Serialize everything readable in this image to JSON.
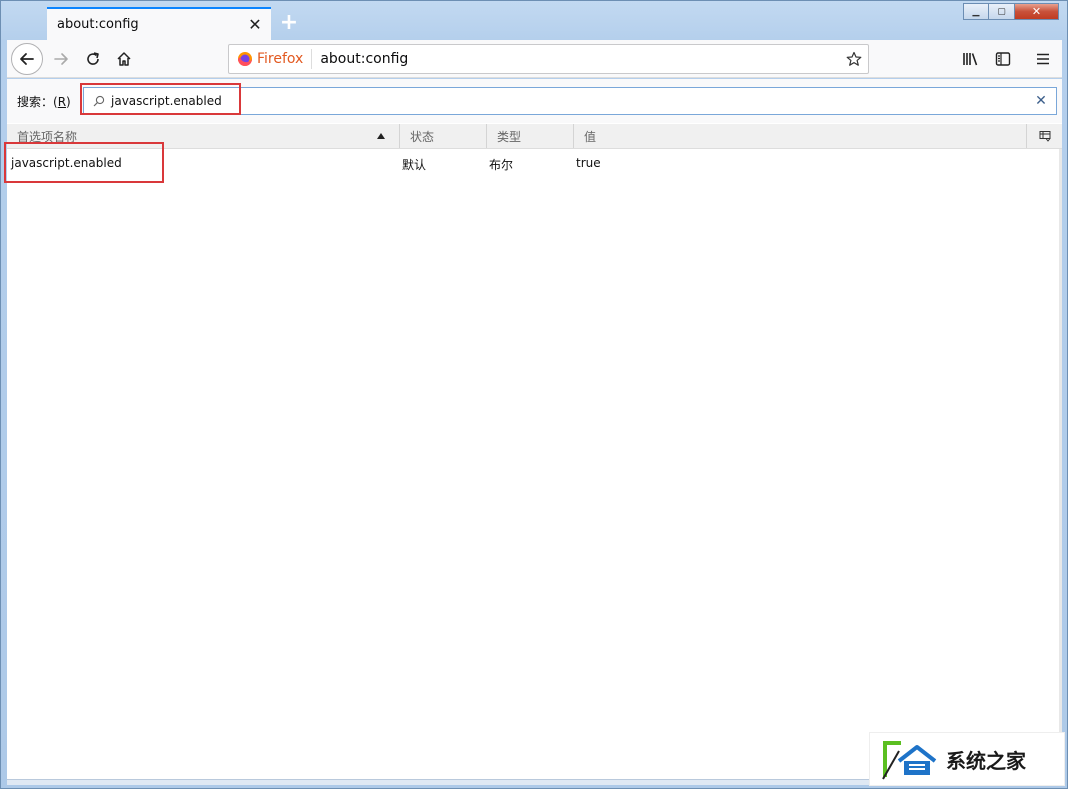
{
  "tab": {
    "title": "about:config",
    "close_label": "✕",
    "new_tab_label": "+"
  },
  "window_controls": {
    "minimize": "▁",
    "maximize": "▢",
    "close": "✕"
  },
  "navbar": {
    "identity_label": "Firefox",
    "url": "about:config"
  },
  "search": {
    "label_prefix": "搜索：(",
    "label_key": "R",
    "label_suffix": ")",
    "value": "javascript.enabled",
    "clear_label": "✕"
  },
  "table": {
    "columns": [
      "首选项名称",
      "状态",
      "类型",
      "值"
    ],
    "sorted_column": "首选项名称",
    "rows": [
      {
        "name": "javascript.enabled",
        "status": "默认",
        "type": "布尔",
        "value": "true"
      }
    ]
  },
  "watermark": {
    "text": "系统之家"
  },
  "colors": {
    "accent": "#0a84ff",
    "highlight_box": "#d9383a",
    "firefox_orange": "#e25920",
    "window_frame": "#b4cfec"
  },
  "icons": [
    "back-arrow-icon",
    "forward-arrow-icon",
    "reload-icon",
    "home-icon",
    "firefox-logo-icon",
    "bookmark-star-icon",
    "library-icon",
    "sidebar-icon",
    "menu-icon",
    "search-icon",
    "clear-icon",
    "sort-ascending-icon",
    "column-picker-icon"
  ]
}
